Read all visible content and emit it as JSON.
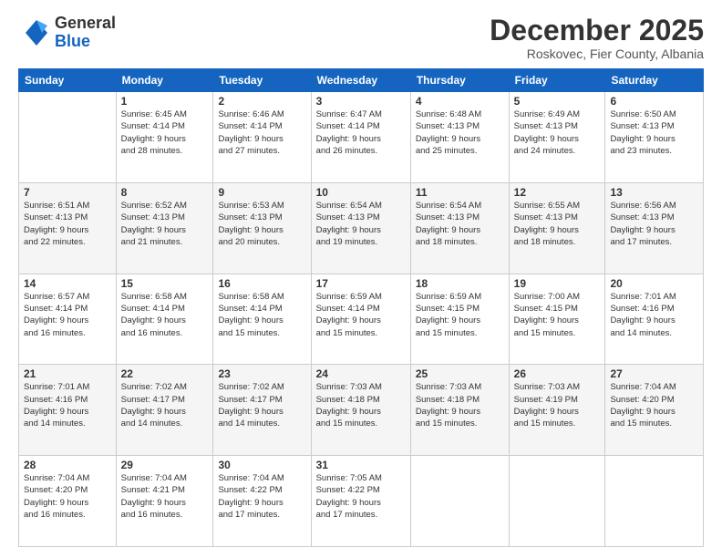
{
  "logo": {
    "line1": "General",
    "line2": "Blue"
  },
  "header": {
    "month": "December 2025",
    "location": "Roskovec, Fier County, Albania"
  },
  "weekdays": [
    "Sunday",
    "Monday",
    "Tuesday",
    "Wednesday",
    "Thursday",
    "Friday",
    "Saturday"
  ],
  "weeks": [
    [
      {
        "day": "",
        "info": ""
      },
      {
        "day": "1",
        "info": "Sunrise: 6:45 AM\nSunset: 4:14 PM\nDaylight: 9 hours\nand 28 minutes."
      },
      {
        "day": "2",
        "info": "Sunrise: 6:46 AM\nSunset: 4:14 PM\nDaylight: 9 hours\nand 27 minutes."
      },
      {
        "day": "3",
        "info": "Sunrise: 6:47 AM\nSunset: 4:14 PM\nDaylight: 9 hours\nand 26 minutes."
      },
      {
        "day": "4",
        "info": "Sunrise: 6:48 AM\nSunset: 4:13 PM\nDaylight: 9 hours\nand 25 minutes."
      },
      {
        "day": "5",
        "info": "Sunrise: 6:49 AM\nSunset: 4:13 PM\nDaylight: 9 hours\nand 24 minutes."
      },
      {
        "day": "6",
        "info": "Sunrise: 6:50 AM\nSunset: 4:13 PM\nDaylight: 9 hours\nand 23 minutes."
      }
    ],
    [
      {
        "day": "7",
        "info": "Sunrise: 6:51 AM\nSunset: 4:13 PM\nDaylight: 9 hours\nand 22 minutes."
      },
      {
        "day": "8",
        "info": "Sunrise: 6:52 AM\nSunset: 4:13 PM\nDaylight: 9 hours\nand 21 minutes."
      },
      {
        "day": "9",
        "info": "Sunrise: 6:53 AM\nSunset: 4:13 PM\nDaylight: 9 hours\nand 20 minutes."
      },
      {
        "day": "10",
        "info": "Sunrise: 6:54 AM\nSunset: 4:13 PM\nDaylight: 9 hours\nand 19 minutes."
      },
      {
        "day": "11",
        "info": "Sunrise: 6:54 AM\nSunset: 4:13 PM\nDaylight: 9 hours\nand 18 minutes."
      },
      {
        "day": "12",
        "info": "Sunrise: 6:55 AM\nSunset: 4:13 PM\nDaylight: 9 hours\nand 18 minutes."
      },
      {
        "day": "13",
        "info": "Sunrise: 6:56 AM\nSunset: 4:13 PM\nDaylight: 9 hours\nand 17 minutes."
      }
    ],
    [
      {
        "day": "14",
        "info": "Sunrise: 6:57 AM\nSunset: 4:14 PM\nDaylight: 9 hours\nand 16 minutes."
      },
      {
        "day": "15",
        "info": "Sunrise: 6:58 AM\nSunset: 4:14 PM\nDaylight: 9 hours\nand 16 minutes."
      },
      {
        "day": "16",
        "info": "Sunrise: 6:58 AM\nSunset: 4:14 PM\nDaylight: 9 hours\nand 15 minutes."
      },
      {
        "day": "17",
        "info": "Sunrise: 6:59 AM\nSunset: 4:14 PM\nDaylight: 9 hours\nand 15 minutes."
      },
      {
        "day": "18",
        "info": "Sunrise: 6:59 AM\nSunset: 4:15 PM\nDaylight: 9 hours\nand 15 minutes."
      },
      {
        "day": "19",
        "info": "Sunrise: 7:00 AM\nSunset: 4:15 PM\nDaylight: 9 hours\nand 15 minutes."
      },
      {
        "day": "20",
        "info": "Sunrise: 7:01 AM\nSunset: 4:16 PM\nDaylight: 9 hours\nand 14 minutes."
      }
    ],
    [
      {
        "day": "21",
        "info": "Sunrise: 7:01 AM\nSunset: 4:16 PM\nDaylight: 9 hours\nand 14 minutes."
      },
      {
        "day": "22",
        "info": "Sunrise: 7:02 AM\nSunset: 4:17 PM\nDaylight: 9 hours\nand 14 minutes."
      },
      {
        "day": "23",
        "info": "Sunrise: 7:02 AM\nSunset: 4:17 PM\nDaylight: 9 hours\nand 14 minutes."
      },
      {
        "day": "24",
        "info": "Sunrise: 7:03 AM\nSunset: 4:18 PM\nDaylight: 9 hours\nand 15 minutes."
      },
      {
        "day": "25",
        "info": "Sunrise: 7:03 AM\nSunset: 4:18 PM\nDaylight: 9 hours\nand 15 minutes."
      },
      {
        "day": "26",
        "info": "Sunrise: 7:03 AM\nSunset: 4:19 PM\nDaylight: 9 hours\nand 15 minutes."
      },
      {
        "day": "27",
        "info": "Sunrise: 7:04 AM\nSunset: 4:20 PM\nDaylight: 9 hours\nand 15 minutes."
      }
    ],
    [
      {
        "day": "28",
        "info": "Sunrise: 7:04 AM\nSunset: 4:20 PM\nDaylight: 9 hours\nand 16 minutes."
      },
      {
        "day": "29",
        "info": "Sunrise: 7:04 AM\nSunset: 4:21 PM\nDaylight: 9 hours\nand 16 minutes."
      },
      {
        "day": "30",
        "info": "Sunrise: 7:04 AM\nSunset: 4:22 PM\nDaylight: 9 hours\nand 17 minutes."
      },
      {
        "day": "31",
        "info": "Sunrise: 7:05 AM\nSunset: 4:22 PM\nDaylight: 9 hours\nand 17 minutes."
      },
      {
        "day": "",
        "info": ""
      },
      {
        "day": "",
        "info": ""
      },
      {
        "day": "",
        "info": ""
      }
    ]
  ]
}
